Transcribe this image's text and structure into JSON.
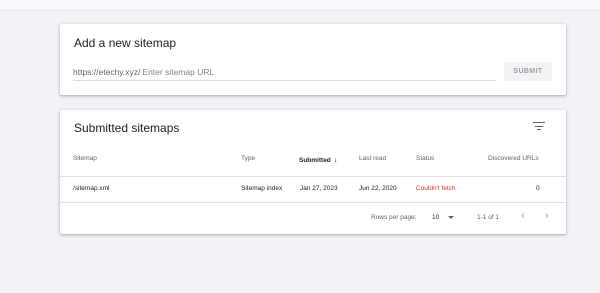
{
  "add_card": {
    "title": "Add a new sitemap",
    "url_prefix": "https://etechy.xyz/",
    "input_value": "",
    "input_placeholder": "Enter sitemap URL",
    "submit_label": "SUBMIT"
  },
  "submitted_card": {
    "title": "Submitted sitemaps",
    "columns": {
      "sitemap": "Sitemap",
      "type": "Type",
      "submitted": "Submitted",
      "last_read": "Last read",
      "status": "Status",
      "discovered_urls": "Discovered URLs"
    },
    "sort_icon": "arrow-down-icon",
    "rows": [
      {
        "sitemap": "/sitemap.xml",
        "type": "Sitemap index",
        "submitted": "Jan 27, 2023",
        "last_read": "Jun 22, 2020",
        "status": "Couldn't fetch",
        "discovered_urls": "0"
      }
    ],
    "pagination": {
      "rows_per_page_label": "Rows per page:",
      "rows_per_page_value": "10",
      "range": "1-1 of 1"
    }
  },
  "colors": {
    "background": "#f1f3f9",
    "error": "#d93025",
    "text": "#202124",
    "muted": "#5f6368"
  }
}
